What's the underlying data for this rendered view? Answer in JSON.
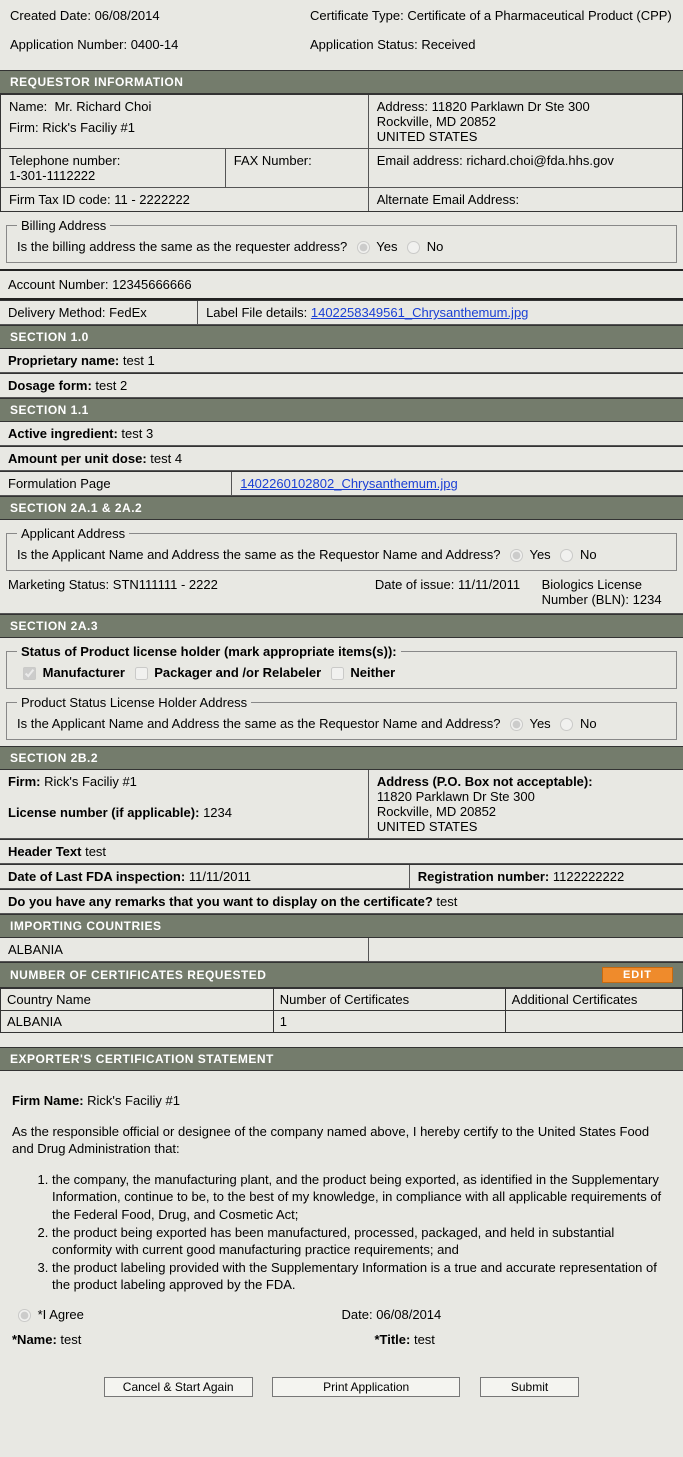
{
  "meta": {
    "created_label": "Created Date:",
    "created_value": "06/08/2014",
    "cert_type_label": "Certificate Type:",
    "cert_type_value": "Certificate of a Pharmaceutical Product (CPP)",
    "app_num_label": "Application Number:",
    "app_num_value": "0400-14",
    "app_status_label": "Application Status:",
    "app_status_value": "Received"
  },
  "requestor": {
    "header": "REQUESTOR INFORMATION",
    "name_label": "Name:",
    "name_value": "Mr. Richard Choi",
    "firm_label": "Firm:",
    "firm_value": "Rick's Faciliy #1",
    "address_label": "Address:",
    "address_lines": "11820 Parklawn Dr Ste 300\nRockville, MD 20852\nUNITED STATES",
    "telephone_label": "Telephone number:",
    "telephone_value": "1-301-1112222",
    "fax_label": "FAX Number:",
    "email_label": "Email address:",
    "email_value": "richard.choi@fda.hhs.gov",
    "tax_label": "Firm Tax ID code:",
    "tax_value": "11 - 2222222",
    "alt_email_label": "Alternate Email Address:",
    "billing_legend": "Billing Address",
    "billing_q": "Is the billing address the same as the requester address?",
    "yes": "Yes",
    "no": "No",
    "account_label": "Account Number:",
    "account_value": "12345666666",
    "delivery_label": "Delivery Method:",
    "delivery_value": "FedEx",
    "label_file_label": "Label File details:",
    "label_file_link": "1402258349561_Chrysanthemum.jpg"
  },
  "section1_0": {
    "header": "SECTION 1.0",
    "prop_label": "Proprietary name:",
    "prop_value": "test 1",
    "dosage_label": "Dosage form:",
    "dosage_value": "test 2"
  },
  "section1_1": {
    "header": "SECTION 1.1",
    "active_label": "Active ingredient:",
    "active_value": "test 3",
    "amount_label": "Amount per unit dose:",
    "amount_value": "test 4",
    "formulation_label": "Formulation Page",
    "formulation_link": "1402260102802_Chrysanthemum.jpg"
  },
  "section2a": {
    "header": "SECTION 2A.1 & 2A.2",
    "applicant_legend": "Applicant Address",
    "applicant_q": "Is the Applicant Name and Address the same as the Requestor Name and Address?",
    "yes": "Yes",
    "no": "No",
    "marketing_label": "Marketing Status:",
    "marketing_value": "STN111111  - 2222",
    "issue_label": "Date of issue:",
    "issue_value": "11/11/2011",
    "bln_label": "Biologics License Number (BLN):",
    "bln_value": "1234"
  },
  "section2a3": {
    "header": "SECTION 2A.3",
    "status_legend": "Status of Product license holder (mark appropriate items(s)):",
    "manufacturer": "Manufacturer",
    "packager": "Packager and /or Relabeler",
    "neither": "Neither",
    "pslh_legend": "Product Status License Holder Address",
    "pslh_q": "Is the Applicant Name and Address the same as the Requestor Name and Address?",
    "yes": "Yes",
    "no": "No"
  },
  "section2b2": {
    "header": "SECTION 2B.2",
    "firm_label": "Firm:",
    "firm_value": "Rick's Faciliy #1",
    "address_label": "Address (P.O. Box not acceptable):",
    "address_lines": "11820 Parklawn Dr Ste 300\nRockville, MD 20852\nUNITED STATES",
    "license_label": "License number (if applicable):",
    "license_value": "1234",
    "header_text_label": "Header Text",
    "header_text_value": "test",
    "inspection_label": "Date of Last FDA inspection:",
    "inspection_value": "11/11/2011",
    "reg_label": "Registration number:",
    "reg_value": "1122222222",
    "remarks_label": "Do you have any remarks that you want to display on the certificate?",
    "remarks_value": "test"
  },
  "importing": {
    "header": "IMPORTING COUNTRIES",
    "country": "ALBANIA"
  },
  "certs": {
    "header": "NUMBER OF CERTIFICATES REQUESTED",
    "edit": "EDIT",
    "col_country": "Country Name",
    "col_num": "Number of Certificates",
    "col_add": "Additional Certificates",
    "row_country": "ALBANIA",
    "row_num": "1",
    "row_add": ""
  },
  "exporter": {
    "header": "EXPORTER'S CERTIFICATION STATEMENT",
    "firm_label": "Firm Name:",
    "firm_value": "Rick's Faciliy #1",
    "intro": "As the responsible official or designee of the company named above, I hereby certify to the United States Food and Drug Administration that:",
    "li1": "the company, the manufacturing plant, and the product being exported, as identified in the Supplementary Information, continue to be, to the best of my knowledge, in compliance with all applicable requirements of the Federal Food, Drug, and Cosmetic Act;",
    "li2": "the product being exported has been manufactured, processed, packaged, and held in substantial conformity with current good manufacturing practice requirements; and",
    "li3": "the product labeling provided with the Supplementary Information is a true and accurate representation of the product labeling approved by the FDA.",
    "agree": "*I Agree",
    "date_label": "Date:",
    "date_value": "06/08/2014",
    "name_label": "*Name:",
    "name_value": "test",
    "title_label": "*Title:",
    "title_value": "test"
  },
  "buttons": {
    "cancel": "Cancel & Start Again",
    "print": "Print Application",
    "submit": "Submit"
  }
}
